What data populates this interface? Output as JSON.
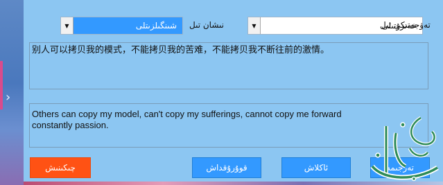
{
  "languages": {
    "source_value": "شىنگىلزىتلى",
    "source_label": "نىشان تىل",
    "target_value": "خەنزۇتىلى",
    "target_label": "تەۋجەتىكى تىل"
  },
  "input_text": "别人可以拷贝我的模式，不能拷贝我的苦难，不能拷贝我不断往前的激情。",
  "output_text": "Others can copy my model, can't copy my sufferings, cannot copy me forward\nconstantly passion.",
  "buttons": {
    "clear": "چىكىنىش",
    "save": "قوۇرۇقداش",
    "back": "ئاكلاش",
    "translate": "تەرجىمە"
  },
  "sidebar": {
    "chevron": "›"
  },
  "logo": {
    "text": "ئالتۇن ئۆتۈش"
  },
  "colors": {
    "panel": "#8cc6f2",
    "button": "#3399ff",
    "clear_button": "#ff5214",
    "logo_green": "#2e8b57"
  }
}
